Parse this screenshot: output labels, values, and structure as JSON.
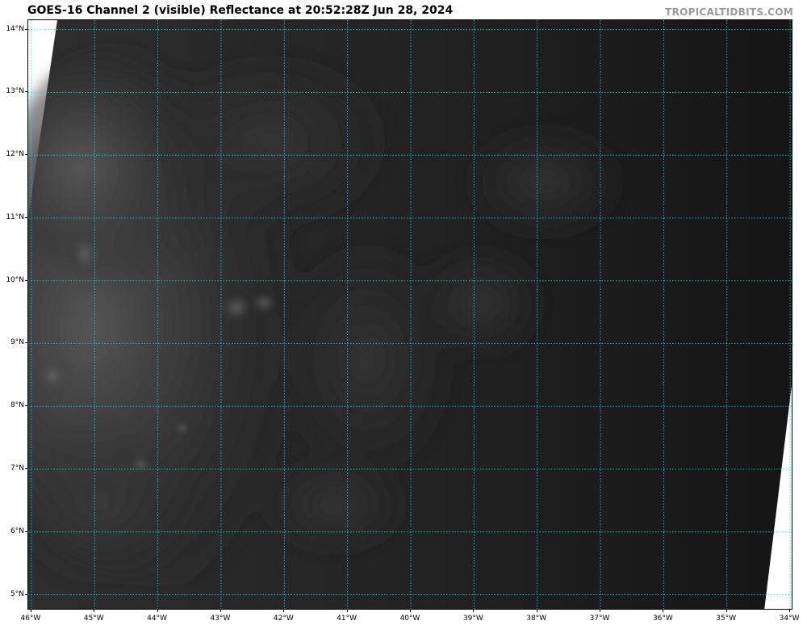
{
  "header": {
    "title": "GOES-16 Channel 2 (visible) Reflectance at 20:52:28Z Jun 28, 2024",
    "credit": "TROPICALTIDBITS.COM"
  },
  "map": {
    "lon_range": [
      -46.05,
      -33.95
    ],
    "lat_range": [
      4.75,
      14.15
    ],
    "grid_color": "#00e5ee",
    "background_color": "#1c1c1c",
    "no_data_color": "#ffffff",
    "lat_ticks": [
      {
        "value": 14,
        "label": "14°N"
      },
      {
        "value": 13,
        "label": "13°N"
      },
      {
        "value": 12,
        "label": "12°N"
      },
      {
        "value": 11,
        "label": "11°N"
      },
      {
        "value": 10,
        "label": "10°N"
      },
      {
        "value": 9,
        "label": "9°N"
      },
      {
        "value": 8,
        "label": "8°N"
      },
      {
        "value": 7,
        "label": "7°N"
      },
      {
        "value": 6,
        "label": "6°N"
      },
      {
        "value": 5,
        "label": "5°N"
      }
    ],
    "lon_ticks": [
      {
        "value": -46,
        "label": "46°W"
      },
      {
        "value": -45,
        "label": "45°W"
      },
      {
        "value": -44,
        "label": "44°W"
      },
      {
        "value": -43,
        "label": "43°W"
      },
      {
        "value": -42,
        "label": "42°W"
      },
      {
        "value": -41,
        "label": "41°W"
      },
      {
        "value": -40,
        "label": "40°W"
      },
      {
        "value": -39,
        "label": "39°W"
      },
      {
        "value": -38,
        "label": "38°W"
      },
      {
        "value": -37,
        "label": "37°W"
      },
      {
        "value": -36,
        "label": "36°W"
      },
      {
        "value": -35,
        "label": "35°W"
      },
      {
        "value": -34,
        "label": "34°W"
      }
    ]
  }
}
